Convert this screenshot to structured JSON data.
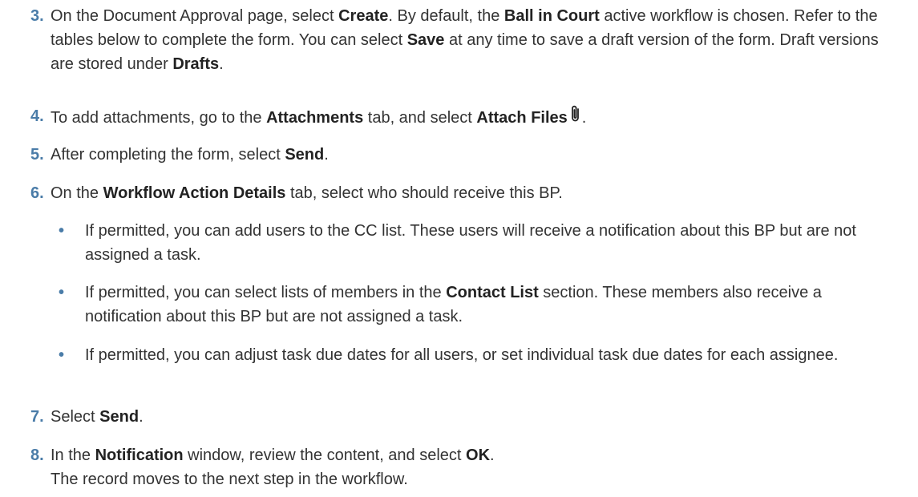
{
  "colors": {
    "step_number": "#4a7ca8",
    "text": "#333333"
  },
  "steps": [
    {
      "number": "3.",
      "parts": [
        "On the Document Approval page, select ",
        "Create",
        ". By default, the ",
        "Ball in Court",
        " active workflow is chosen. Refer to the tables below to complete the form. You can select ",
        "Save",
        " at any time to save a draft version of the form. Draft versions are stored under ",
        "Drafts",
        "."
      ]
    },
    {
      "number": "4.",
      "parts": [
        "To add attachments, go to the ",
        "Attachments",
        " tab, and select ",
        "Attach Files",
        "."
      ],
      "icon": "paperclip-icon"
    },
    {
      "number": "5.",
      "parts": [
        "After completing the form, select ",
        "Send",
        "."
      ]
    },
    {
      "number": "6.",
      "parts": [
        "On the ",
        "Workflow Action Details",
        " tab, select who should receive this BP."
      ]
    },
    {
      "number": "7.",
      "parts": [
        "Select ",
        "Send",
        "."
      ]
    },
    {
      "number": "8.",
      "parts": [
        "In the ",
        "Notification",
        " window, review the content, and select ",
        "OK",
        "."
      ],
      "line2": "The record moves to the next step in the workflow."
    }
  ],
  "bullets": [
    {
      "symbol": "•",
      "parts": [
        "If permitted, you can add users to the CC list. These users will receive a notification about this BP but are not assigned a task."
      ]
    },
    {
      "symbol": "•",
      "parts": [
        "If permitted, you can select lists of members in the ",
        "Contact List",
        " section. These members also receive a notification about this BP but are not assigned a task."
      ]
    },
    {
      "symbol": "•",
      "parts": [
        "If permitted, you can adjust task due dates for all users, or set individual task due dates for each assignee."
      ]
    }
  ]
}
